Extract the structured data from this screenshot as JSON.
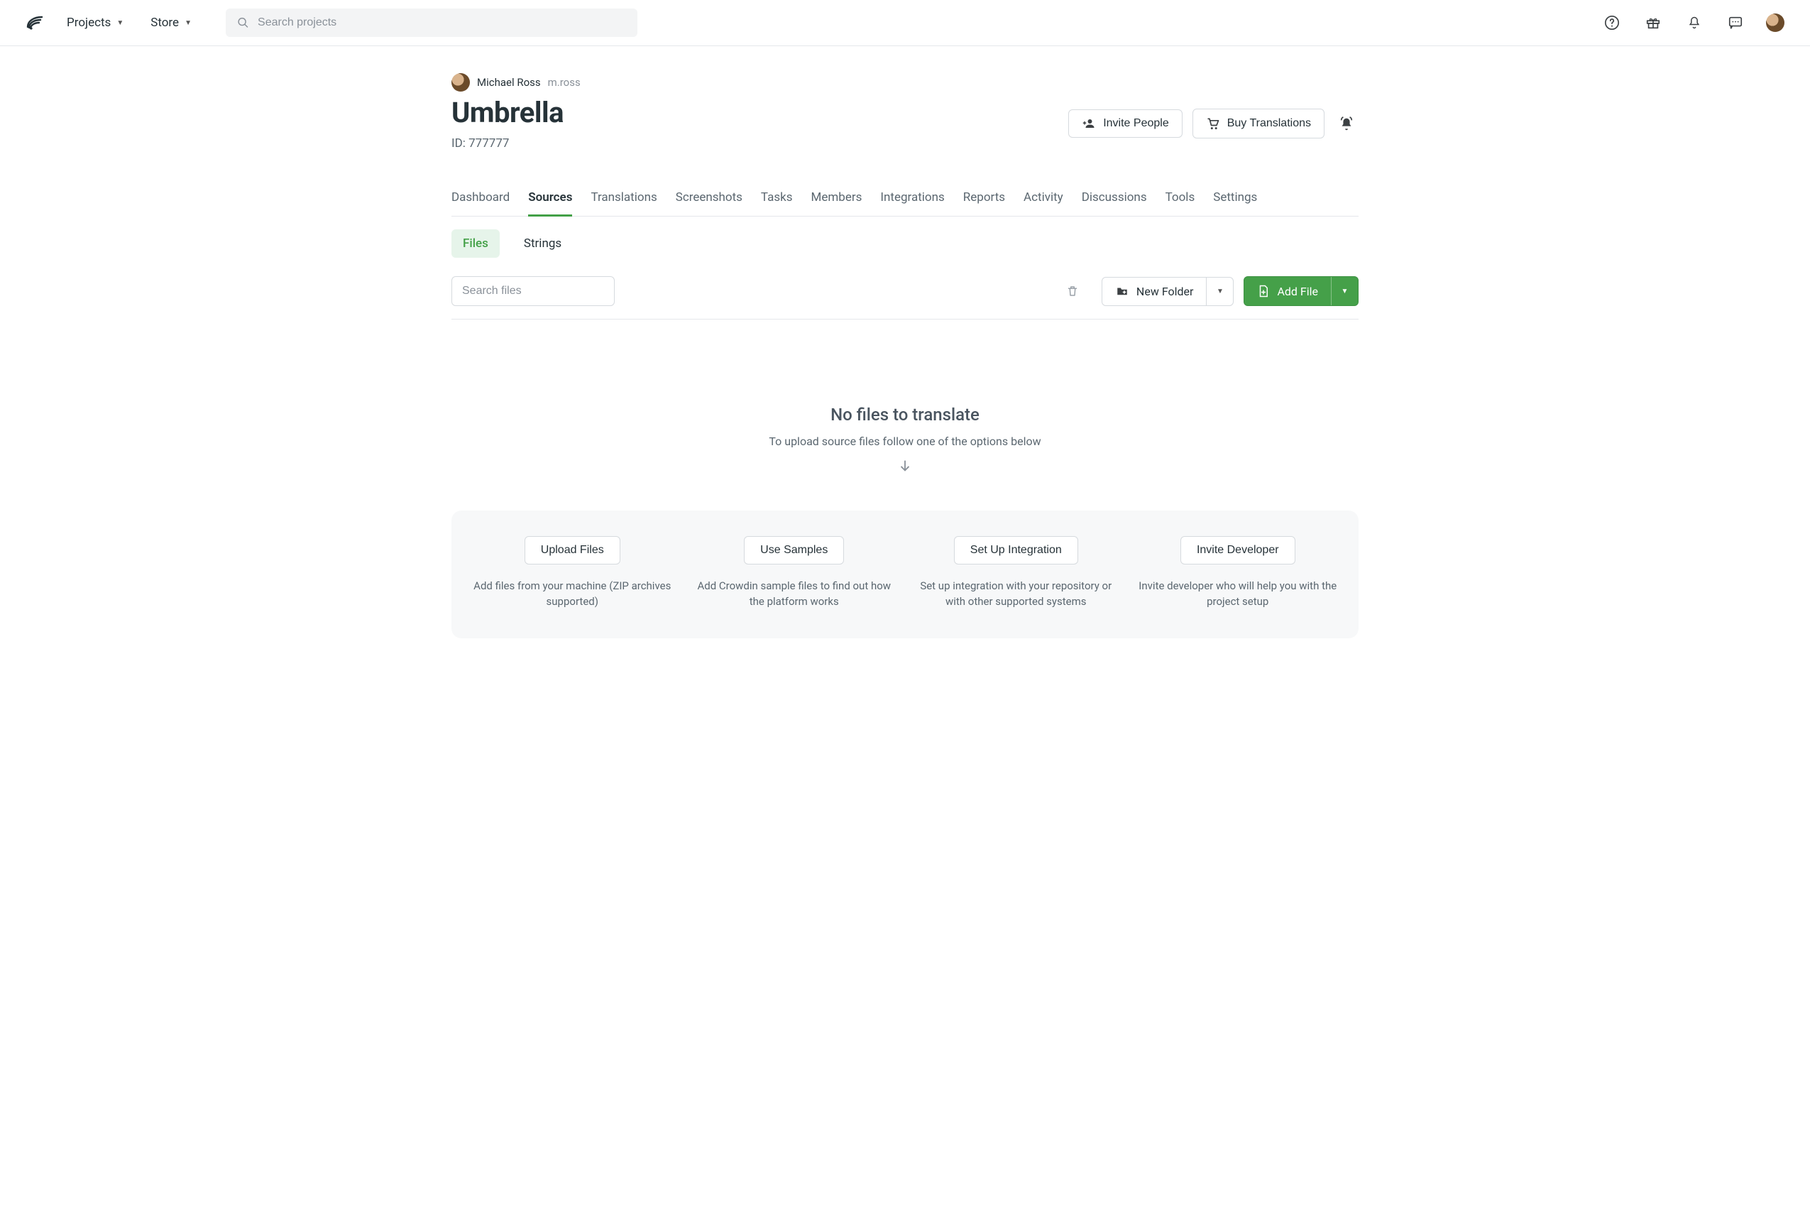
{
  "nav": {
    "projects": "Projects",
    "store": "Store"
  },
  "search": {
    "placeholder": "Search projects"
  },
  "owner": {
    "name": "Michael Ross",
    "handle": "m.ross"
  },
  "project": {
    "title": "Umbrella",
    "id_label": "ID: 777777"
  },
  "actions": {
    "invite": "Invite People",
    "buy": "Buy Translations"
  },
  "tabs": [
    "Dashboard",
    "Sources",
    "Translations",
    "Screenshots",
    "Tasks",
    "Members",
    "Integrations",
    "Reports",
    "Activity",
    "Discussions",
    "Tools",
    "Settings"
  ],
  "active_tab": "Sources",
  "subtabs": {
    "files": "Files",
    "strings": "Strings"
  },
  "active_subtab": "Files",
  "files_toolbar": {
    "search_placeholder": "Search files",
    "new_folder": "New Folder",
    "add_file": "Add File"
  },
  "empty": {
    "title": "No files to translate",
    "subtitle": "To upload source files follow one of the options below"
  },
  "options": [
    {
      "button": "Upload Files",
      "desc": "Add files from your machine (ZIP archives supported)"
    },
    {
      "button": "Use Samples",
      "desc": "Add Crowdin sample files to find out how the platform works"
    },
    {
      "button": "Set Up Integration",
      "desc": "Set up integration with your repository or with other supported systems"
    },
    {
      "button": "Invite Developer",
      "desc": "Invite developer who will help you with the project setup"
    }
  ]
}
